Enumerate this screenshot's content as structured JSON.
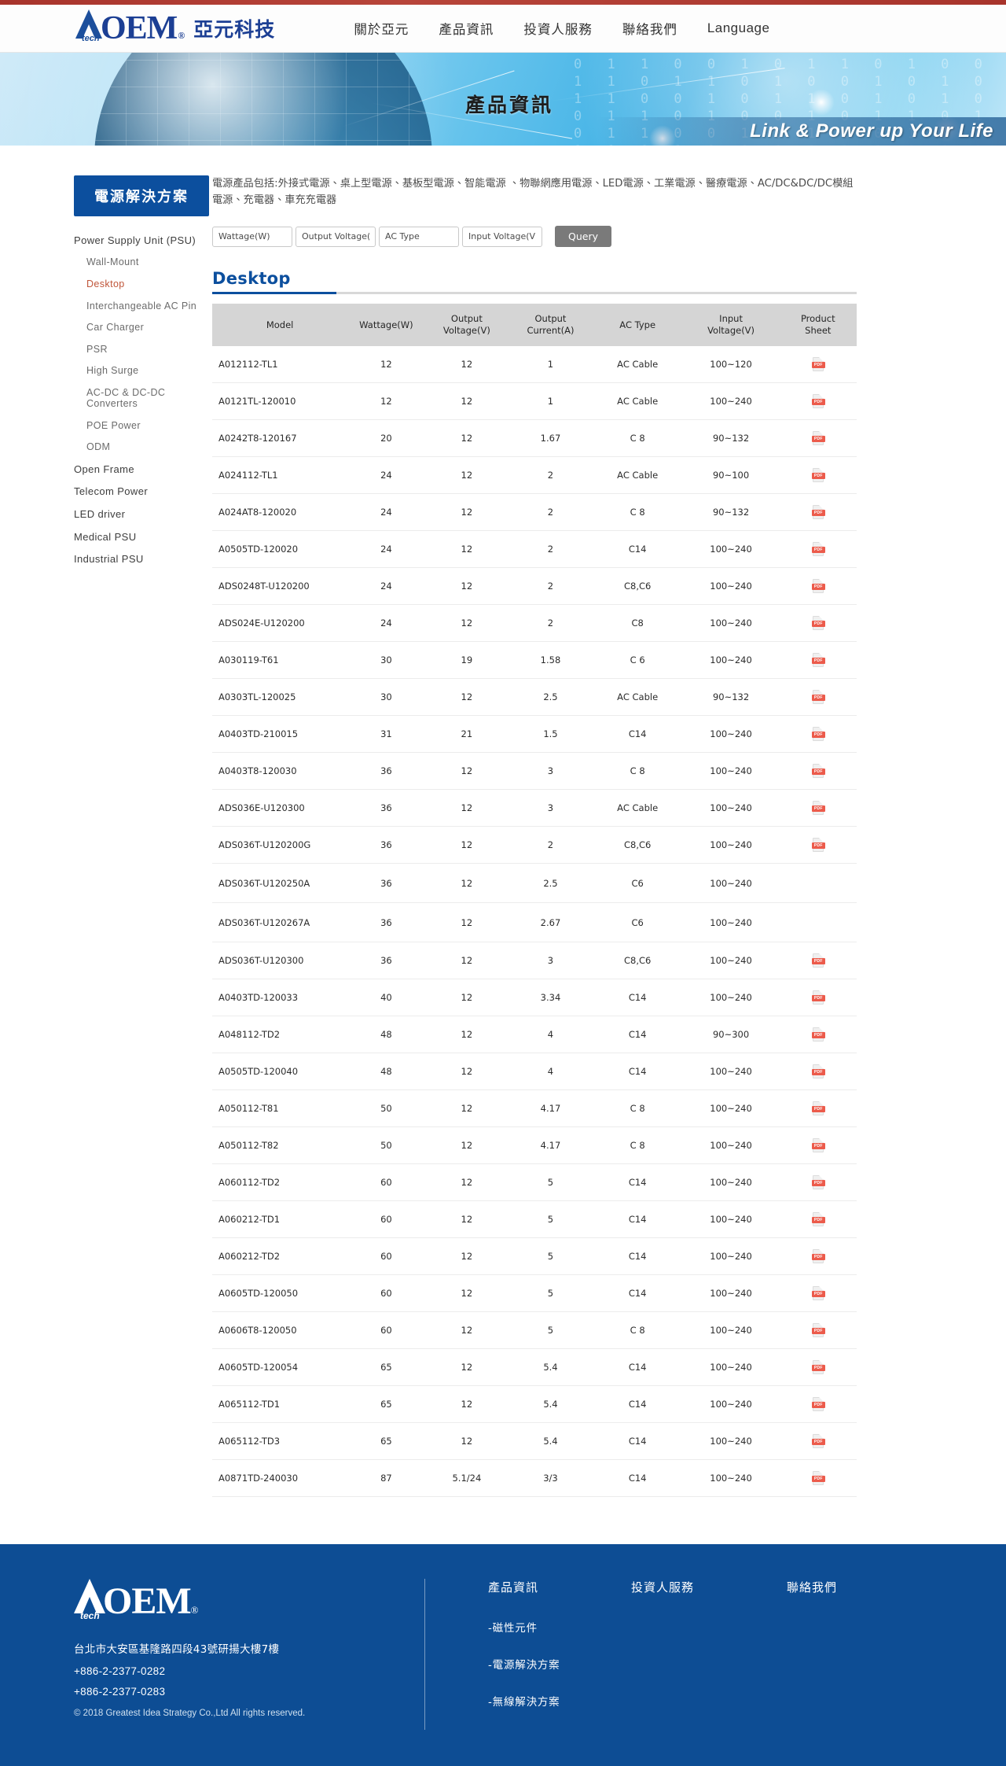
{
  "header": {
    "logo": {
      "mark": "OEM",
      "tech": "tech",
      "reg": "®",
      "cn": "亞元科技"
    },
    "nav": [
      {
        "label": "關於亞元"
      },
      {
        "label": "產品資訊"
      },
      {
        "label": "投資人服務"
      },
      {
        "label": "聯絡我們"
      },
      {
        "label": "Language"
      }
    ]
  },
  "banner": {
    "title": "產品資訊",
    "slogan": "Link & Power up Your Life",
    "binary": "0 1 1 0 0 1 0 1 1 0 1 0 0 1 1 0 1 1 0 1 0 0 1 0 1 0 1 1 0 0 1 0 1 1 0 1 0 1 0 0 1 1 0 1 0 0 1 0 1 1 0 1 0 1 1 0 0 1 0 1 1 0 1 0 0 1 1 0 1 1 0 1 0 0 1 0 1 0 1 1 0 0 1 0 1 1 0 1 0 1"
  },
  "sidebar": {
    "heading": "電源解決方案",
    "items": [
      {
        "label": "Power Supply Unit (PSU)",
        "level": 1,
        "active": false
      },
      {
        "label": "Wall-Mount",
        "level": 2,
        "active": false
      },
      {
        "label": "Desktop",
        "level": 2,
        "active": true
      },
      {
        "label": "Interchangeable AC Pin",
        "level": 2,
        "active": false
      },
      {
        "label": "Car Charger",
        "level": 2,
        "active": false
      },
      {
        "label": "PSR",
        "level": 2,
        "active": false
      },
      {
        "label": "High Surge",
        "level": 2,
        "active": false
      },
      {
        "label": "AC-DC & DC-DC Converters",
        "level": 2,
        "active": false
      },
      {
        "label": "POE Power",
        "level": 2,
        "active": false
      },
      {
        "label": "ODM",
        "level": 2,
        "active": false
      },
      {
        "label": "Open Frame",
        "level": 1,
        "active": false
      },
      {
        "label": "Telecom Power",
        "level": 1,
        "active": false
      },
      {
        "label": "LED driver",
        "level": 1,
        "active": false
      },
      {
        "label": "Medical PSU",
        "level": 1,
        "active": false
      },
      {
        "label": "Industrial PSU",
        "level": 1,
        "active": false
      }
    ]
  },
  "main": {
    "description": "電源產品包括:外接式電源、桌上型電源、基板型電源、智能電源 、物聯網應用電源、LED電源、工業電源、醫療電源、AC/DC&DC/DC模組電源、充電器、車充充電器",
    "filters": [
      {
        "name": "wattage",
        "placeholder": "Wattage(W)",
        "value": ""
      },
      {
        "name": "output-voltage",
        "placeholder": "Output Voltage(V)",
        "value": ""
      },
      {
        "name": "ac-type",
        "placeholder": "AC Type",
        "value": ""
      },
      {
        "name": "input-voltage",
        "placeholder": "Input Voltage(V)",
        "value": ""
      }
    ],
    "query_button": "Query",
    "section_title": "Desktop",
    "table": {
      "columns": [
        "Model",
        "Wattage(W)",
        "Output Voltage(V)",
        "Output Current(A)",
        "AC Type",
        "Input Voltage(V)",
        "Product Sheet"
      ],
      "columns_multiline": [
        [
          "Model"
        ],
        [
          "Wattage(W)"
        ],
        [
          "Output",
          "Voltage(V)"
        ],
        [
          "Output",
          "Current(A)"
        ],
        [
          "AC Type"
        ],
        [
          "Input",
          "Voltage(V)"
        ],
        [
          "Product",
          "Sheet"
        ]
      ],
      "rows": [
        {
          "model": "A012112-TL1",
          "wattage": "12",
          "output_voltage": "12",
          "output_current": "1",
          "ac_type": "AC Cable",
          "input_voltage": "100~120",
          "sheet": true
        },
        {
          "model": "A0121TL-120010",
          "wattage": "12",
          "output_voltage": "12",
          "output_current": "1",
          "ac_type": "AC Cable",
          "input_voltage": "100~240",
          "sheet": true
        },
        {
          "model": "A0242T8-120167",
          "wattage": "20",
          "output_voltage": "12",
          "output_current": "1.67",
          "ac_type": "C 8",
          "input_voltage": "90~132",
          "sheet": true
        },
        {
          "model": "A024112-TL1",
          "wattage": "24",
          "output_voltage": "12",
          "output_current": "2",
          "ac_type": "AC Cable",
          "input_voltage": "90~100",
          "sheet": true
        },
        {
          "model": "A024AT8-120020",
          "wattage": "24",
          "output_voltage": "12",
          "output_current": "2",
          "ac_type": "C 8",
          "input_voltage": "90~132",
          "sheet": true
        },
        {
          "model": "A0505TD-120020",
          "wattage": "24",
          "output_voltage": "12",
          "output_current": "2",
          "ac_type": "C14",
          "input_voltage": "100~240",
          "sheet": true
        },
        {
          "model": "ADS0248T-U120200",
          "wattage": "24",
          "output_voltage": "12",
          "output_current": "2",
          "ac_type": "C8,C6",
          "input_voltage": "100~240",
          "sheet": true
        },
        {
          "model": "ADS024E-U120200",
          "wattage": "24",
          "output_voltage": "12",
          "output_current": "2",
          "ac_type": "C8",
          "input_voltage": "100~240",
          "sheet": true
        },
        {
          "model": "A030119-T61",
          "wattage": "30",
          "output_voltage": "19",
          "output_current": "1.58",
          "ac_type": "C 6",
          "input_voltage": "100~240",
          "sheet": true
        },
        {
          "model": "A0303TL-120025",
          "wattage": "30",
          "output_voltage": "12",
          "output_current": "2.5",
          "ac_type": "AC Cable",
          "input_voltage": "90~132",
          "sheet": true
        },
        {
          "model": "A0403TD-210015",
          "wattage": "31",
          "output_voltage": "21",
          "output_current": "1.5",
          "ac_type": "C14",
          "input_voltage": "100~240",
          "sheet": true
        },
        {
          "model": "A0403T8-120030",
          "wattage": "36",
          "output_voltage": "12",
          "output_current": "3",
          "ac_type": "C 8",
          "input_voltage": "100~240",
          "sheet": true
        },
        {
          "model": "ADS036E-U120300",
          "wattage": "36",
          "output_voltage": "12",
          "output_current": "3",
          "ac_type": "AC Cable",
          "input_voltage": "100~240",
          "sheet": true
        },
        {
          "model": "ADS036T-U120200G",
          "wattage": "36",
          "output_voltage": "12",
          "output_current": "2",
          "ac_type": "C8,C6",
          "input_voltage": "100~240",
          "sheet": true
        },
        {
          "model": "ADS036T-U120250A",
          "wattage": "36",
          "output_voltage": "12",
          "output_current": "2.5",
          "ac_type": "C6",
          "input_voltage": "100~240",
          "sheet": false
        },
        {
          "model": "ADS036T-U120267A",
          "wattage": "36",
          "output_voltage": "12",
          "output_current": "2.67",
          "ac_type": "C6",
          "input_voltage": "100~240",
          "sheet": false
        },
        {
          "model": "ADS036T-U120300",
          "wattage": "36",
          "output_voltage": "12",
          "output_current": "3",
          "ac_type": "C8,C6",
          "input_voltage": "100~240",
          "sheet": true
        },
        {
          "model": "A0403TD-120033",
          "wattage": "40",
          "output_voltage": "12",
          "output_current": "3.34",
          "ac_type": "C14",
          "input_voltage": "100~240",
          "sheet": true
        },
        {
          "model": "A048112-TD2",
          "wattage": "48",
          "output_voltage": "12",
          "output_current": "4",
          "ac_type": "C14",
          "input_voltage": "90~300",
          "sheet": true
        },
        {
          "model": "A0505TD-120040",
          "wattage": "48",
          "output_voltage": "12",
          "output_current": "4",
          "ac_type": "C14",
          "input_voltage": "100~240",
          "sheet": true
        },
        {
          "model": "A050112-T81",
          "wattage": "50",
          "output_voltage": "12",
          "output_current": "4.17",
          "ac_type": "C 8",
          "input_voltage": "100~240",
          "sheet": true
        },
        {
          "model": "A050112-T82",
          "wattage": "50",
          "output_voltage": "12",
          "output_current": "4.17",
          "ac_type": "C 8",
          "input_voltage": "100~240",
          "sheet": true
        },
        {
          "model": "A060112-TD2",
          "wattage": "60",
          "output_voltage": "12",
          "output_current": "5",
          "ac_type": "C14",
          "input_voltage": "100~240",
          "sheet": true
        },
        {
          "model": "A060212-TD1",
          "wattage": "60",
          "output_voltage": "12",
          "output_current": "5",
          "ac_type": "C14",
          "input_voltage": "100~240",
          "sheet": true
        },
        {
          "model": "A060212-TD2",
          "wattage": "60",
          "output_voltage": "12",
          "output_current": "5",
          "ac_type": "C14",
          "input_voltage": "100~240",
          "sheet": true
        },
        {
          "model": "A0605TD-120050",
          "wattage": "60",
          "output_voltage": "12",
          "output_current": "5",
          "ac_type": "C14",
          "input_voltage": "100~240",
          "sheet": true
        },
        {
          "model": "A0606T8-120050",
          "wattage": "60",
          "output_voltage": "12",
          "output_current": "5",
          "ac_type": "C 8",
          "input_voltage": "100~240",
          "sheet": true
        },
        {
          "model": "A0605TD-120054",
          "wattage": "65",
          "output_voltage": "12",
          "output_current": "5.4",
          "ac_type": "C14",
          "input_voltage": "100~240",
          "sheet": true
        },
        {
          "model": "A065112-TD1",
          "wattage": "65",
          "output_voltage": "12",
          "output_current": "5.4",
          "ac_type": "C14",
          "input_voltage": "100~240",
          "sheet": true
        },
        {
          "model": "A065112-TD3",
          "wattage": "65",
          "output_voltage": "12",
          "output_current": "5.4",
          "ac_type": "C14",
          "input_voltage": "100~240",
          "sheet": true
        },
        {
          "model": "A0871TD-240030",
          "wattage": "87",
          "output_voltage": "5.1/24",
          "output_current": "3/3",
          "ac_type": "C14",
          "input_voltage": "100~240",
          "sheet": true
        }
      ]
    }
  },
  "footer": {
    "logo": {
      "mark": "OEM",
      "tech": "tech",
      "reg": "®"
    },
    "address": "台北市大安區基隆路四段43號研揚大樓7樓",
    "tel1": "+886-2-2377-0282",
    "tel2": "+886-2-2377-0283",
    "copyright": "© 2018 Greatest Idea Strategy Co.,Ltd All rights reserved.",
    "columns": [
      {
        "title": "產品資訊"
      },
      {
        "title": "投資人服務"
      },
      {
        "title": "聯絡我們"
      }
    ],
    "sublinks": [
      {
        "label": "-磁性元件"
      },
      {
        "label": "-電源解決方案"
      },
      {
        "label": "-無線解決方案"
      }
    ]
  },
  "colors": {
    "brand_blue": "#0c4f9e",
    "accent_red": "#a8342c",
    "active_link": "#c0563a",
    "table_header_bg": "#d5d5d5",
    "query_button_bg": "#7a7a7a",
    "footer_bg": "#0d4d94",
    "pdf_red": "#ec5b4b"
  }
}
